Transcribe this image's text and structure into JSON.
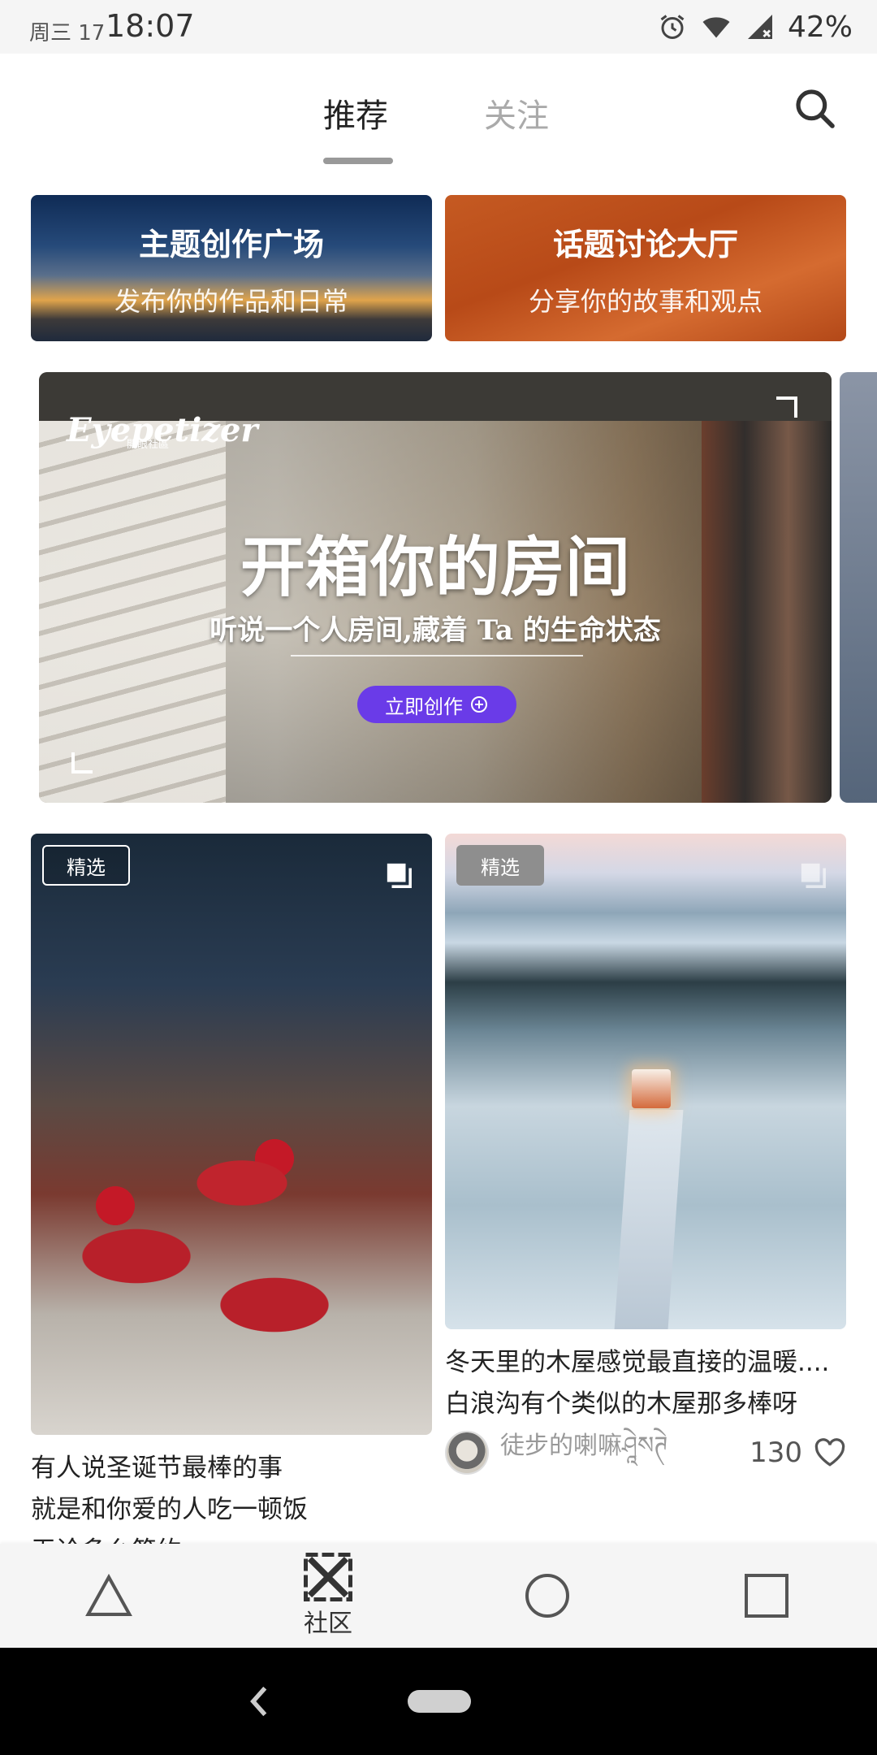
{
  "status_bar": {
    "date": "周三 17",
    "time": "18:07",
    "battery": "42%"
  },
  "top_tabs": {
    "active": "推荐",
    "inactive": "关注"
  },
  "entries": [
    {
      "title": "主题创作广场",
      "subtitle": "发布你的作品和日常"
    },
    {
      "title": "话题讨论大厅",
      "subtitle": "分享你的故事和观点"
    }
  ],
  "banner": {
    "logo": "Eyepetizer",
    "logo_sub": "開眼社區",
    "title": "开箱你的房间",
    "subtitle": "听说一个人房间,藏着 Ta 的生命状态",
    "button_label": "立即创作"
  },
  "feed": [
    {
      "badge": "精选",
      "title": "有人说圣诞节最棒的事\n就是和你爱的人吃一顿饭\n无论多么简约"
    },
    {
      "badge": "精选",
      "title": "冬天里的木屋感觉最直接的温暖....白浪沟有个类似的木屋那多棒呀",
      "author": "徒步的喇嘛ཤཱེསཊེ",
      "likes": "130"
    }
  ],
  "bottom_nav": {
    "community_label": "社区"
  },
  "colors": {
    "accent_purple": "#6a3be8",
    "entry_orange": "#c55a22"
  }
}
